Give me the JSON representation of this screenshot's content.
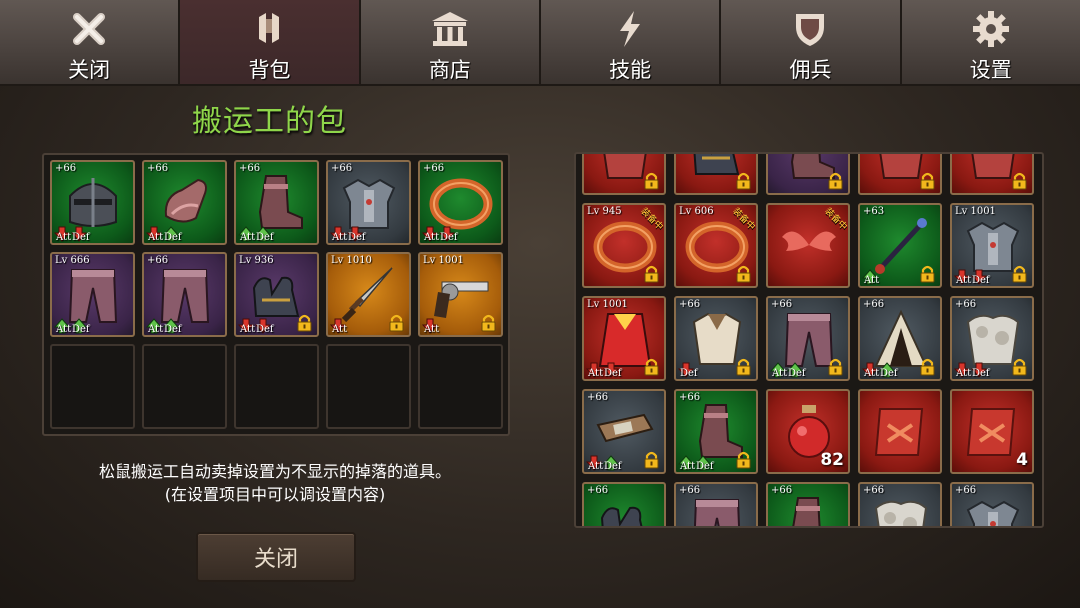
{
  "nav": {
    "tabs": [
      {
        "label": "关闭",
        "icon": "close-icon"
      },
      {
        "label": "背包",
        "icon": "backpack-icon"
      },
      {
        "label": "商店",
        "icon": "shop-icon"
      },
      {
        "label": "技能",
        "icon": "lightning-icon"
      },
      {
        "label": "佣兵",
        "icon": "shield-icon"
      },
      {
        "label": "设置",
        "icon": "gear-icon"
      }
    ],
    "active_index": 1
  },
  "bag": {
    "title": "搬运工的包",
    "items": [
      {
        "lv": "+66",
        "icon": "helmet-icon",
        "rarity": "green",
        "att": "down",
        "def": "down",
        "att_label": "Att",
        "def_label": "Def"
      },
      {
        "lv": "+66",
        "icon": "gauntlet-icon",
        "rarity": "green",
        "att": "down",
        "def": "up",
        "att_label": "Att",
        "def_label": "Def"
      },
      {
        "lv": "+66",
        "icon": "boot-icon",
        "rarity": "green",
        "att": "up",
        "def": "up",
        "att_label": "Att",
        "def_label": "Def"
      },
      {
        "lv": "+66",
        "icon": "chest-armor-icon",
        "rarity": "gray",
        "att": "down",
        "def": "down",
        "att_label": "Att",
        "def_label": "Def"
      },
      {
        "lv": "+66",
        "icon": "ring-icon",
        "rarity": "green",
        "att": "down",
        "def": "down",
        "att_label": "Att",
        "def_label": "Def"
      },
      {
        "lv": "Lv 666",
        "icon": "pants-icon",
        "rarity": "purple",
        "att": "up",
        "def": "up",
        "att_label": "Att",
        "def_label": "Def"
      },
      {
        "lv": "+66",
        "icon": "pants-icon",
        "rarity": "purple",
        "att": "up",
        "def": "up",
        "att_label": "Att",
        "def_label": "Def"
      },
      {
        "lv": "Lv 936",
        "icon": "gloves-icon",
        "rarity": "purple",
        "att": "down",
        "def": "down",
        "att_label": "Att",
        "def_label": "Def",
        "locked": true
      },
      {
        "lv": "Lv 1010",
        "icon": "dagger-icon",
        "rarity": "orange",
        "att": "down",
        "att_label": "Att",
        "locked": true
      },
      {
        "lv": "Lv 1001",
        "icon": "revolver-icon",
        "rarity": "orange",
        "att": "down",
        "att_label": "Att",
        "locked": true
      }
    ],
    "empty_slots": 5,
    "note_line1": "松鼠搬运工自动卖掉设置为不显示的掉落的道具。",
    "note_line2": "(在设置项目中可以调设置内容)",
    "close_label": "关闭"
  },
  "inventory": {
    "items": [
      {
        "icon": "armor-icon",
        "rarity": "red",
        "locked": true
      },
      {
        "icon": "gloves-icon",
        "rarity": "red",
        "locked": true
      },
      {
        "icon": "boot-icon",
        "rarity": "purple",
        "locked": true
      },
      {
        "icon": "armor-icon",
        "rarity": "red",
        "locked": true
      },
      {
        "icon": "armor-icon",
        "rarity": "red",
        "locked": true
      },
      {
        "lv": "Lv 945",
        "tag": "装备中",
        "icon": "ring-icon",
        "rarity": "red",
        "locked": true
      },
      {
        "lv": "Lv 606",
        "tag": "装备中",
        "icon": "ring-icon",
        "rarity": "red",
        "locked": true
      },
      {
        "tag": "装备中",
        "icon": "wings-icon",
        "rarity": "red"
      },
      {
        "lv": "+63",
        "icon": "wand-icon",
        "rarity": "green",
        "att": "up",
        "att_label": "Att",
        "locked": true
      },
      {
        "lv": "Lv 1001",
        "icon": "chest-armor-icon",
        "rarity": "gray",
        "att": "down",
        "def": "down",
        "att_label": "Att",
        "def_label": "Def",
        "locked": true
      },
      {
        "lv": "Lv 1001",
        "icon": "robe-icon",
        "rarity": "red",
        "att": "down",
        "def": "down",
        "att_label": "Att",
        "def_label": "Def",
        "locked": true
      },
      {
        "lv": "+66",
        "icon": "shirt-icon",
        "rarity": "gray",
        "def": "down",
        "def_label": "Def",
        "locked": true
      },
      {
        "lv": "+66",
        "icon": "pants-icon",
        "rarity": "gray",
        "att": "up",
        "def": "up",
        "att_label": "Att",
        "def_label": "Def",
        "locked": true
      },
      {
        "lv": "+66",
        "icon": "cloak-icon",
        "rarity": "gray",
        "att": "down",
        "def": "up",
        "att_label": "Att",
        "def_label": "Def",
        "locked": true
      },
      {
        "lv": "+66",
        "icon": "fur-icon",
        "rarity": "gray",
        "att": "down",
        "def": "down",
        "att_label": "Att",
        "def_label": "Def",
        "locked": true
      },
      {
        "lv": "+66",
        "icon": "bracer-icon",
        "rarity": "gray",
        "att": "down",
        "def": "up",
        "att_label": "Att",
        "def_label": "Def",
        "locked": true
      },
      {
        "lv": "+66",
        "icon": "boot-icon",
        "rarity": "green",
        "att": "up",
        "def": "up",
        "att_label": "Att",
        "def_label": "Def",
        "locked": true
      },
      {
        "icon": "potion-icon",
        "rarity": "red",
        "count": "82"
      },
      {
        "icon": "scroll-icon",
        "rarity": "red"
      },
      {
        "icon": "scroll-icon",
        "rarity": "red",
        "count": "4"
      },
      {
        "lv": "+66",
        "icon": "gloves-icon",
        "rarity": "green"
      },
      {
        "lv": "+66",
        "icon": "pants-icon",
        "rarity": "gray"
      },
      {
        "lv": "+66",
        "icon": "boot-icon",
        "rarity": "green"
      },
      {
        "lv": "+66",
        "icon": "fur-icon",
        "rarity": "gray"
      },
      {
        "lv": "+66",
        "icon": "chest-armor-icon",
        "rarity": "gray"
      }
    ]
  },
  "colors": {
    "title": "#8fd64a",
    "up_arrow": "#5fc24a",
    "down_arrow": "#d9352b",
    "lock": "#f2b81c"
  }
}
